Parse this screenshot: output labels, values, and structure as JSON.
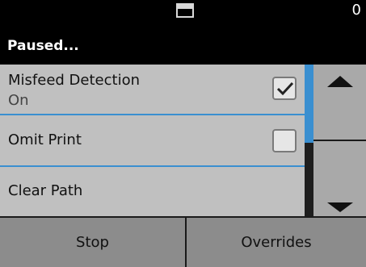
{
  "header": {
    "page_count": "0",
    "status": "Paused...",
    "document_icon": "document-feed-icon"
  },
  "options": [
    {
      "label": "Misfeed Detection",
      "value": "On",
      "checked": true
    },
    {
      "label": "Omit Print",
      "checked": false
    },
    {
      "label": "Clear Path"
    }
  ],
  "scroll": {
    "up_icon": "arrow-up-icon",
    "down_icon": "arrow-down-icon",
    "position_fraction": 0.0,
    "visible_fraction": 0.52
  },
  "footer": {
    "stop_label": "Stop",
    "overrides_label": "Overrides"
  },
  "colors": {
    "accent": "#3a8fd0",
    "header_bg": "#000000",
    "list_bg": "#c0c0c0",
    "button_bg": "#8c8c8c"
  }
}
